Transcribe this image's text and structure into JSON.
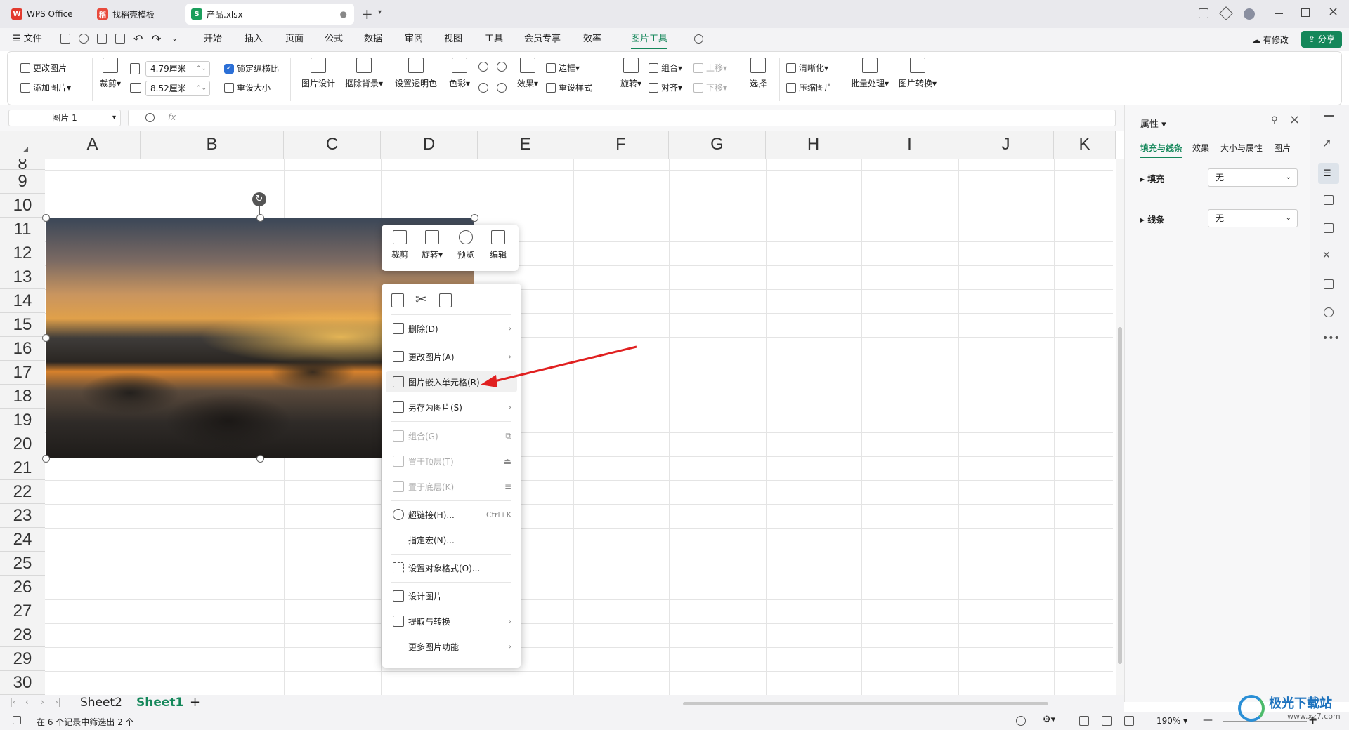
{
  "tabs": [
    {
      "label": "WPS Office"
    },
    {
      "label": "找稻壳模板"
    },
    {
      "label": "产品.xlsx"
    }
  ],
  "menu": {
    "file": "文件",
    "items": [
      "开始",
      "插入",
      "页面",
      "公式",
      "数据",
      "审阅",
      "视图",
      "工具",
      "会员专享",
      "效率",
      "图片工具"
    ],
    "modified": "有修改",
    "share": "分享"
  },
  "ribbon": {
    "change_pic": "更改图片",
    "add_pic": "添加图片",
    "crop": "裁剪",
    "width": "4.79厘米",
    "height": "8.52厘米",
    "lock_ratio": "锁定纵横比",
    "reset_size": "重设大小",
    "pic_design": "图片设计",
    "remove_bg": "抠除背景",
    "set_transparent": "设置透明色",
    "color": "色彩",
    "effect": "效果",
    "border": "边框",
    "reset_style": "重设样式",
    "rotate": "旋转",
    "group": "组合",
    "align": "对齐",
    "up": "上移",
    "down": "下移",
    "select": "选择",
    "clarify": "清晰化",
    "compress": "压缩图片",
    "batch": "批量处理",
    "convert": "图片转换"
  },
  "formula": {
    "namebox": "图片 1",
    "fx": "fx"
  },
  "columns": [
    "A",
    "B",
    "C",
    "D",
    "E",
    "F",
    "G",
    "H",
    "I",
    "J",
    "K"
  ],
  "rows": [
    "8",
    "9",
    "10",
    "11",
    "12",
    "13",
    "14",
    "15",
    "16",
    "17",
    "18",
    "19",
    "20",
    "21",
    "22",
    "23",
    "24",
    "25",
    "26",
    "27",
    "28",
    "29",
    "30"
  ],
  "minitb": {
    "crop": "裁剪",
    "rotate": "旋转",
    "preview": "预览",
    "edit": "编辑"
  },
  "ctx": {
    "delete": "删除(D)",
    "change": "更改图片(A)",
    "embed": "图片嵌入单元格(R)",
    "saveas": "另存为图片(S)",
    "group": "组合(G)",
    "top": "置于顶层(T)",
    "bottom": "置于底层(K)",
    "hyperlink": "超链接(H)...",
    "hyperlink_key": "Ctrl+K",
    "macro": "指定宏(N)...",
    "format": "设置对象格式(O)...",
    "design": "设计图片",
    "extract": "提取与转换",
    "more": "更多图片功能"
  },
  "panel": {
    "title": "属性",
    "tabs": [
      "填充与线条",
      "效果",
      "大小与属性",
      "图片"
    ],
    "fill_label": "填充",
    "fill_val": "无",
    "line_label": "线条",
    "line_val": "无"
  },
  "sheets": [
    "Sheet2",
    "Sheet1"
  ],
  "status": {
    "text": "在 6 个记录中筛选出 2 个",
    "zoom": "190%"
  },
  "watermark": "极光下载站",
  "watermark_url": "www.xz7.com"
}
